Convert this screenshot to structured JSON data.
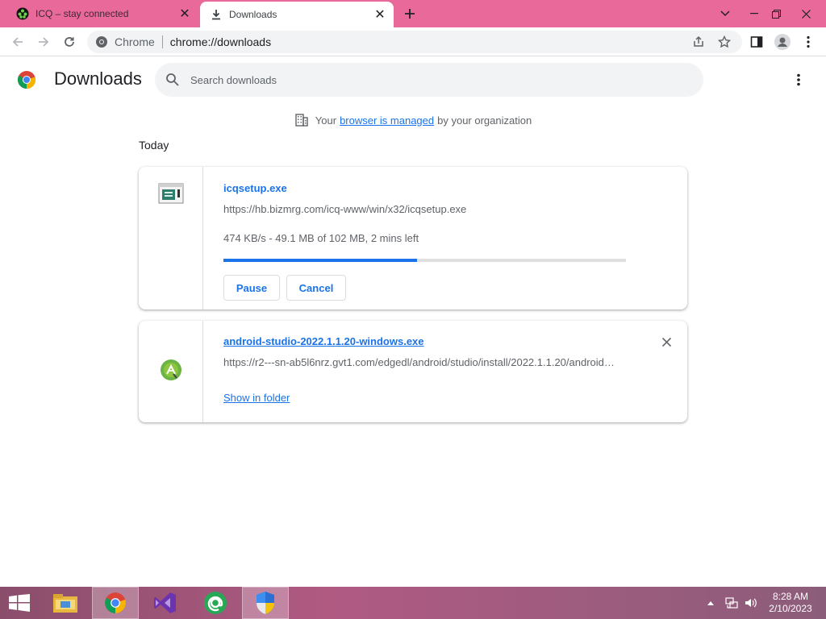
{
  "tabs": [
    {
      "title": "ICQ – stay connected",
      "icon": "icq-icon",
      "active": false
    },
    {
      "title": "Downloads",
      "icon": "download-icon",
      "active": true
    }
  ],
  "omnibox": {
    "chip": "Chrome",
    "url": "chrome://downloads"
  },
  "page": {
    "title": "Downloads",
    "search_placeholder": "Search downloads"
  },
  "managed_notice": {
    "prefix": "Your",
    "link": "browser is managed",
    "suffix": "by your organization"
  },
  "section_date": "Today",
  "downloads": [
    {
      "file_name": "icqsetup.exe",
      "url": "https://hb.bizmrg.com/icq-www/win/x32/icqsetup.exe",
      "status": "474 KB/s - 49.1 MB of 102 MB, 2 mins left",
      "progress_fraction": 0.48,
      "actions": [
        "Pause",
        "Cancel"
      ]
    },
    {
      "file_name": "android-studio-2022.1.1.20-windows.exe",
      "url": "https://r2---sn-ab5l6nrz.gvt1.com/edgedl/android/studio/install/2022.1.1.20/android…",
      "action": "Show in folder"
    }
  ],
  "taskbar": {
    "items": [
      "start-button",
      "file-explorer",
      "chrome",
      "visual-studio",
      "mail-app",
      "uac-shield"
    ],
    "time": "8:28 AM",
    "date": "2/10/2023"
  },
  "colors": {
    "accent": "#1a73e8",
    "titlebar": "#e8699a"
  }
}
